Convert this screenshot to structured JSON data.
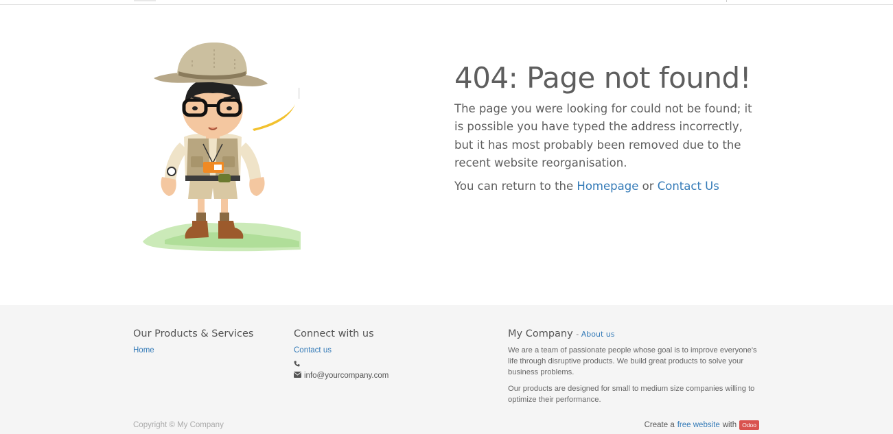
{
  "error": {
    "title": "404: Page not found!",
    "message": "The page you were looking for could not be found; it is possible you have typed the address incorrectly, but it has most probably been removed due to the recent website reorganisation.",
    "return_prefix": "You can return to the",
    "homepage_link": "Homepage",
    "or_text": "or",
    "contact_link": "Contact Us"
  },
  "footer": {
    "products": {
      "heading": "Our Products & Services",
      "links": [
        "Home"
      ]
    },
    "connect": {
      "heading": "Connect with us",
      "contact_link": "Contact us",
      "phone": "",
      "email": "info@yourcompany.com"
    },
    "company": {
      "heading": "My Company",
      "separator": "-",
      "about_link": "About us",
      "para1": "We are a team of passionate people whose goal is to improve everyone's life through disruptive products. We build great products to solve your business problems.",
      "para2": "Our products are designed for small to medium size companies willing to optimize their performance."
    },
    "copyright": "Copyright © My Company",
    "powered": {
      "prefix": "Create a",
      "link": "free website",
      "with": "with",
      "badge": "Odoo"
    }
  },
  "icons": [
    "phone-icon",
    "envelope-icon"
  ],
  "colors": {
    "link": "#337ab7",
    "badge": "#d9534f",
    "footer_bg": "#f5f5f5"
  }
}
